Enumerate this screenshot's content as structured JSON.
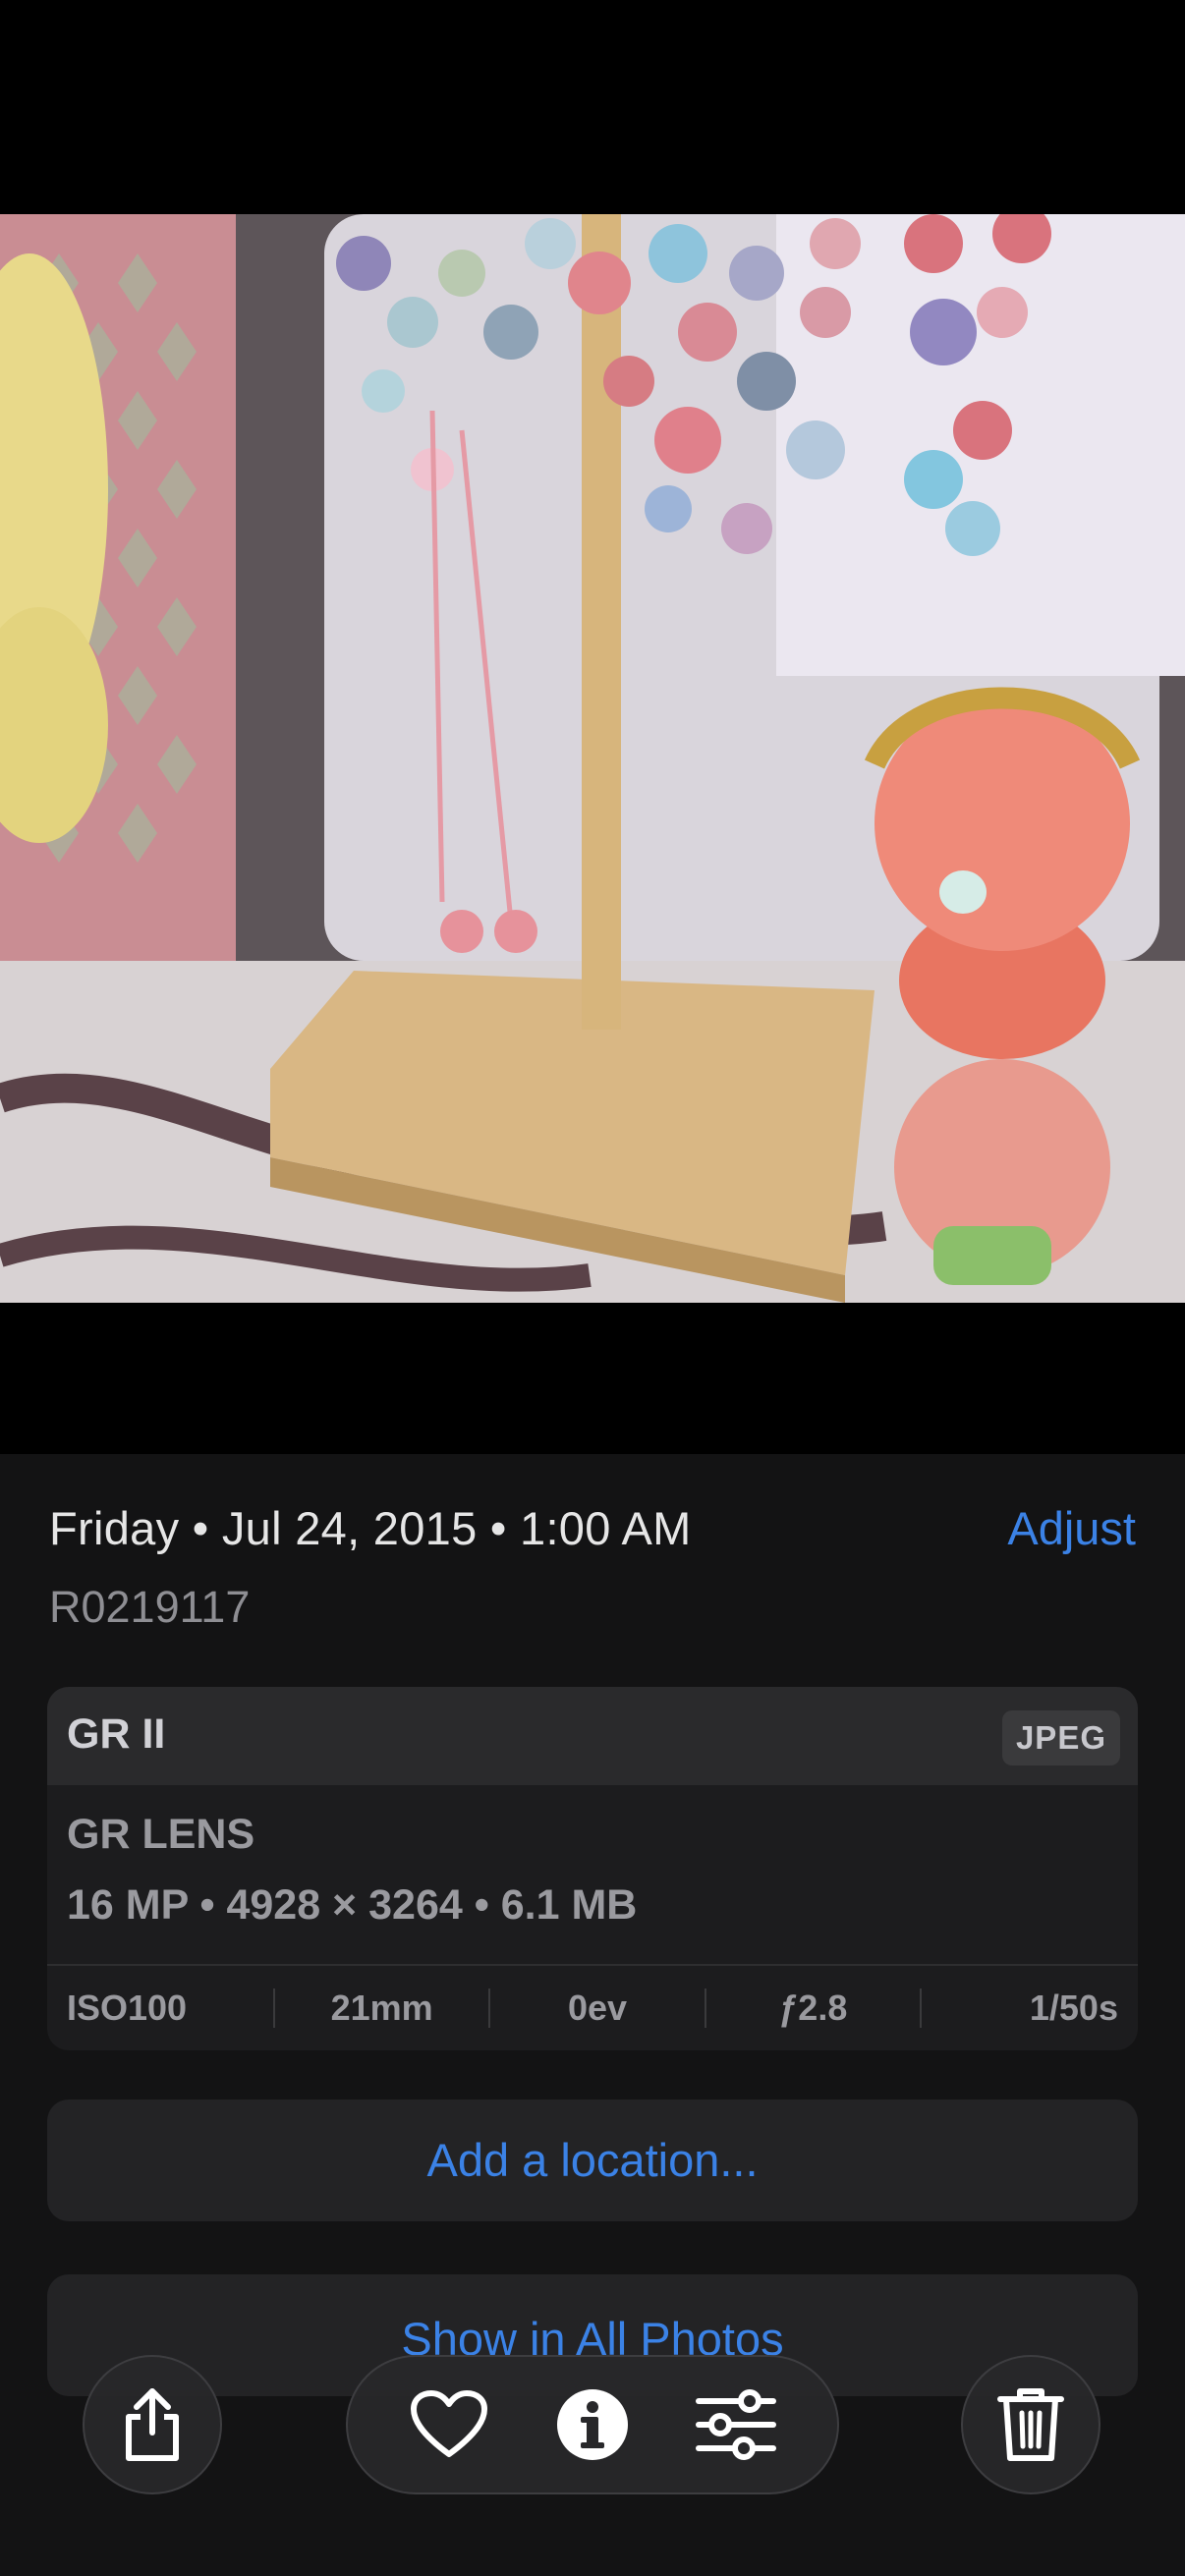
{
  "photo": {
    "description_icon": "photo-content"
  },
  "info": {
    "date_line": "Friday • Jul 24, 2015 • 1:00 AM",
    "adjust_label": "Adjust",
    "filename": "R0219117"
  },
  "metadata": {
    "camera": "GR II",
    "format": "JPEG",
    "lens": "GR LENS",
    "specs": "16 MP • 4928 × 3264 • 6.1 MB",
    "exif": {
      "iso": "ISO100",
      "focal_length": "21mm",
      "exposure": "0ev",
      "aperture": "ƒ2.8",
      "shutter": "1/50s"
    }
  },
  "actions": {
    "add_location": "Add a location...",
    "show_all_photos": "Show in All Photos"
  },
  "toolbar": {
    "icons": [
      "share-icon",
      "heart-icon",
      "info-icon",
      "sliders-icon",
      "trash-icon"
    ]
  },
  "colors": {
    "accent": "#3b82e6",
    "panel": "#131314",
    "card": "#1c1c1e"
  }
}
